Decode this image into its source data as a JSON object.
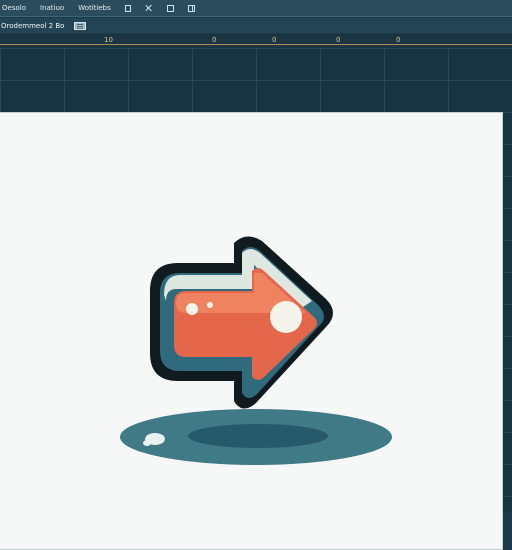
{
  "menubar": {
    "items": [
      "Oesolo",
      "Inatiuo",
      "Wotitiebs"
    ]
  },
  "toolbar": {
    "document_title": "Orodemmeol 2 Bo"
  },
  "ruler": {
    "labels": [
      "10",
      "0",
      "0",
      "0",
      "0"
    ]
  },
  "colors": {
    "background": "#1d3a4a",
    "canvas": "#f6f8f8",
    "arrow_fill": "#e4664b",
    "arrow_rim": "#2f6b7d",
    "shadow": "#3f7a86"
  },
  "canvas": {
    "icon": "arrow-right-icon"
  }
}
